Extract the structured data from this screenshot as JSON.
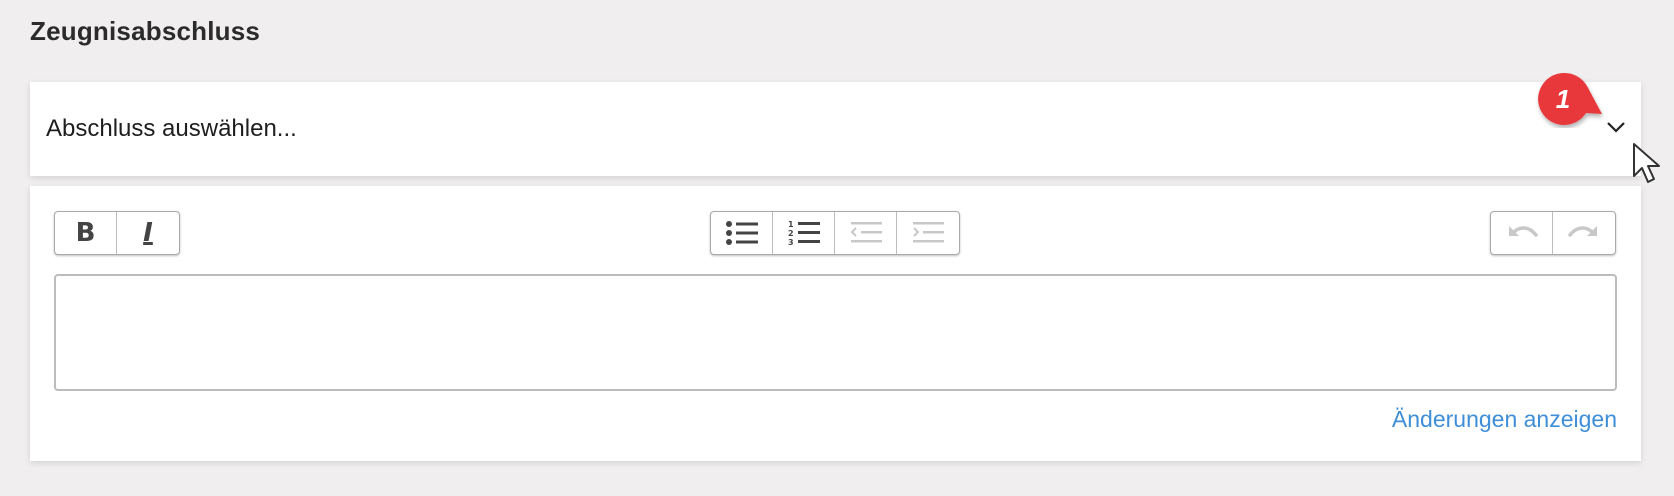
{
  "section": {
    "title": "Zeugnisabschluss"
  },
  "select": {
    "placeholder": "Abschluss auswählen...",
    "icon": "chevron-down-icon"
  },
  "annotation": {
    "badge_number": "1",
    "badge_color": "#e8373a"
  },
  "toolbar": {
    "format_buttons": [
      {
        "name": "bold",
        "glyph": "B"
      },
      {
        "name": "italic",
        "glyph": "I"
      }
    ],
    "list_buttons": [
      {
        "name": "bullet-list",
        "icon": "bullet-list-icon",
        "enabled": true
      },
      {
        "name": "numbered-list",
        "icon": "numbered-list-icon",
        "enabled": true
      },
      {
        "name": "outdent",
        "icon": "outdent-icon",
        "enabled": false
      },
      {
        "name": "indent",
        "icon": "indent-icon",
        "enabled": false
      }
    ],
    "history_buttons": [
      {
        "name": "undo",
        "icon": "undo-icon",
        "enabled": false
      },
      {
        "name": "redo",
        "icon": "redo-icon",
        "enabled": false
      }
    ]
  },
  "editor": {
    "value": ""
  },
  "links": {
    "show_changes": "Änderungen anzeigen",
    "color": "#3e8ed8"
  }
}
